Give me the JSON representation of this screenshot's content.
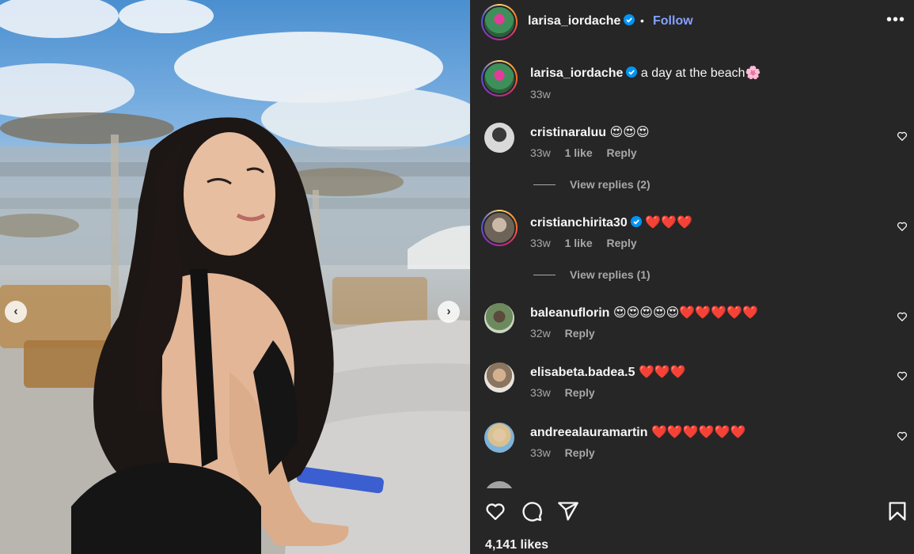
{
  "post": {
    "owner": "larisa_iordache",
    "follow_label": "Follow",
    "separator": "•",
    "more_label": "•••",
    "caption_text": "a day at the beach🌸",
    "caption_time": "33w",
    "likes": "4,141 likes"
  },
  "carousel": {
    "prev": "‹",
    "next": "›"
  },
  "comments": [
    {
      "user": "cristinaraluu",
      "text": "😍😍😍",
      "time": "33w",
      "likes": "1 like",
      "reply": "Reply",
      "verified": false,
      "view_replies": "View replies (2)"
    },
    {
      "user": "cristianchirita30",
      "text": "❤️❤️❤️",
      "time": "33w",
      "likes": "1 like",
      "reply": "Reply",
      "verified": true,
      "view_replies": "View replies (1)"
    },
    {
      "user": "baleanuflorin",
      "text": "😍😍😍😍😍❤️❤️❤️❤️❤️",
      "time": "32w",
      "reply": "Reply"
    },
    {
      "user": "elisabeta.badea.5",
      "text": "❤️❤️❤️",
      "time": "33w",
      "reply": "Reply"
    },
    {
      "user": "andreealauramartin",
      "text": "❤️❤️❤️❤️❤️❤️",
      "time": "33w",
      "reply": "Reply"
    }
  ],
  "colors": {
    "panel_bg": "#262626",
    "link_blue": "#85a1ff",
    "muted": "#a8a8a8",
    "verified_blue": "#0095f6"
  },
  "icons": [
    "verified-icon",
    "more-icon",
    "heart-icon",
    "comment-icon",
    "share-icon",
    "bookmark-icon",
    "chevron-left-icon",
    "chevron-right-icon"
  ]
}
